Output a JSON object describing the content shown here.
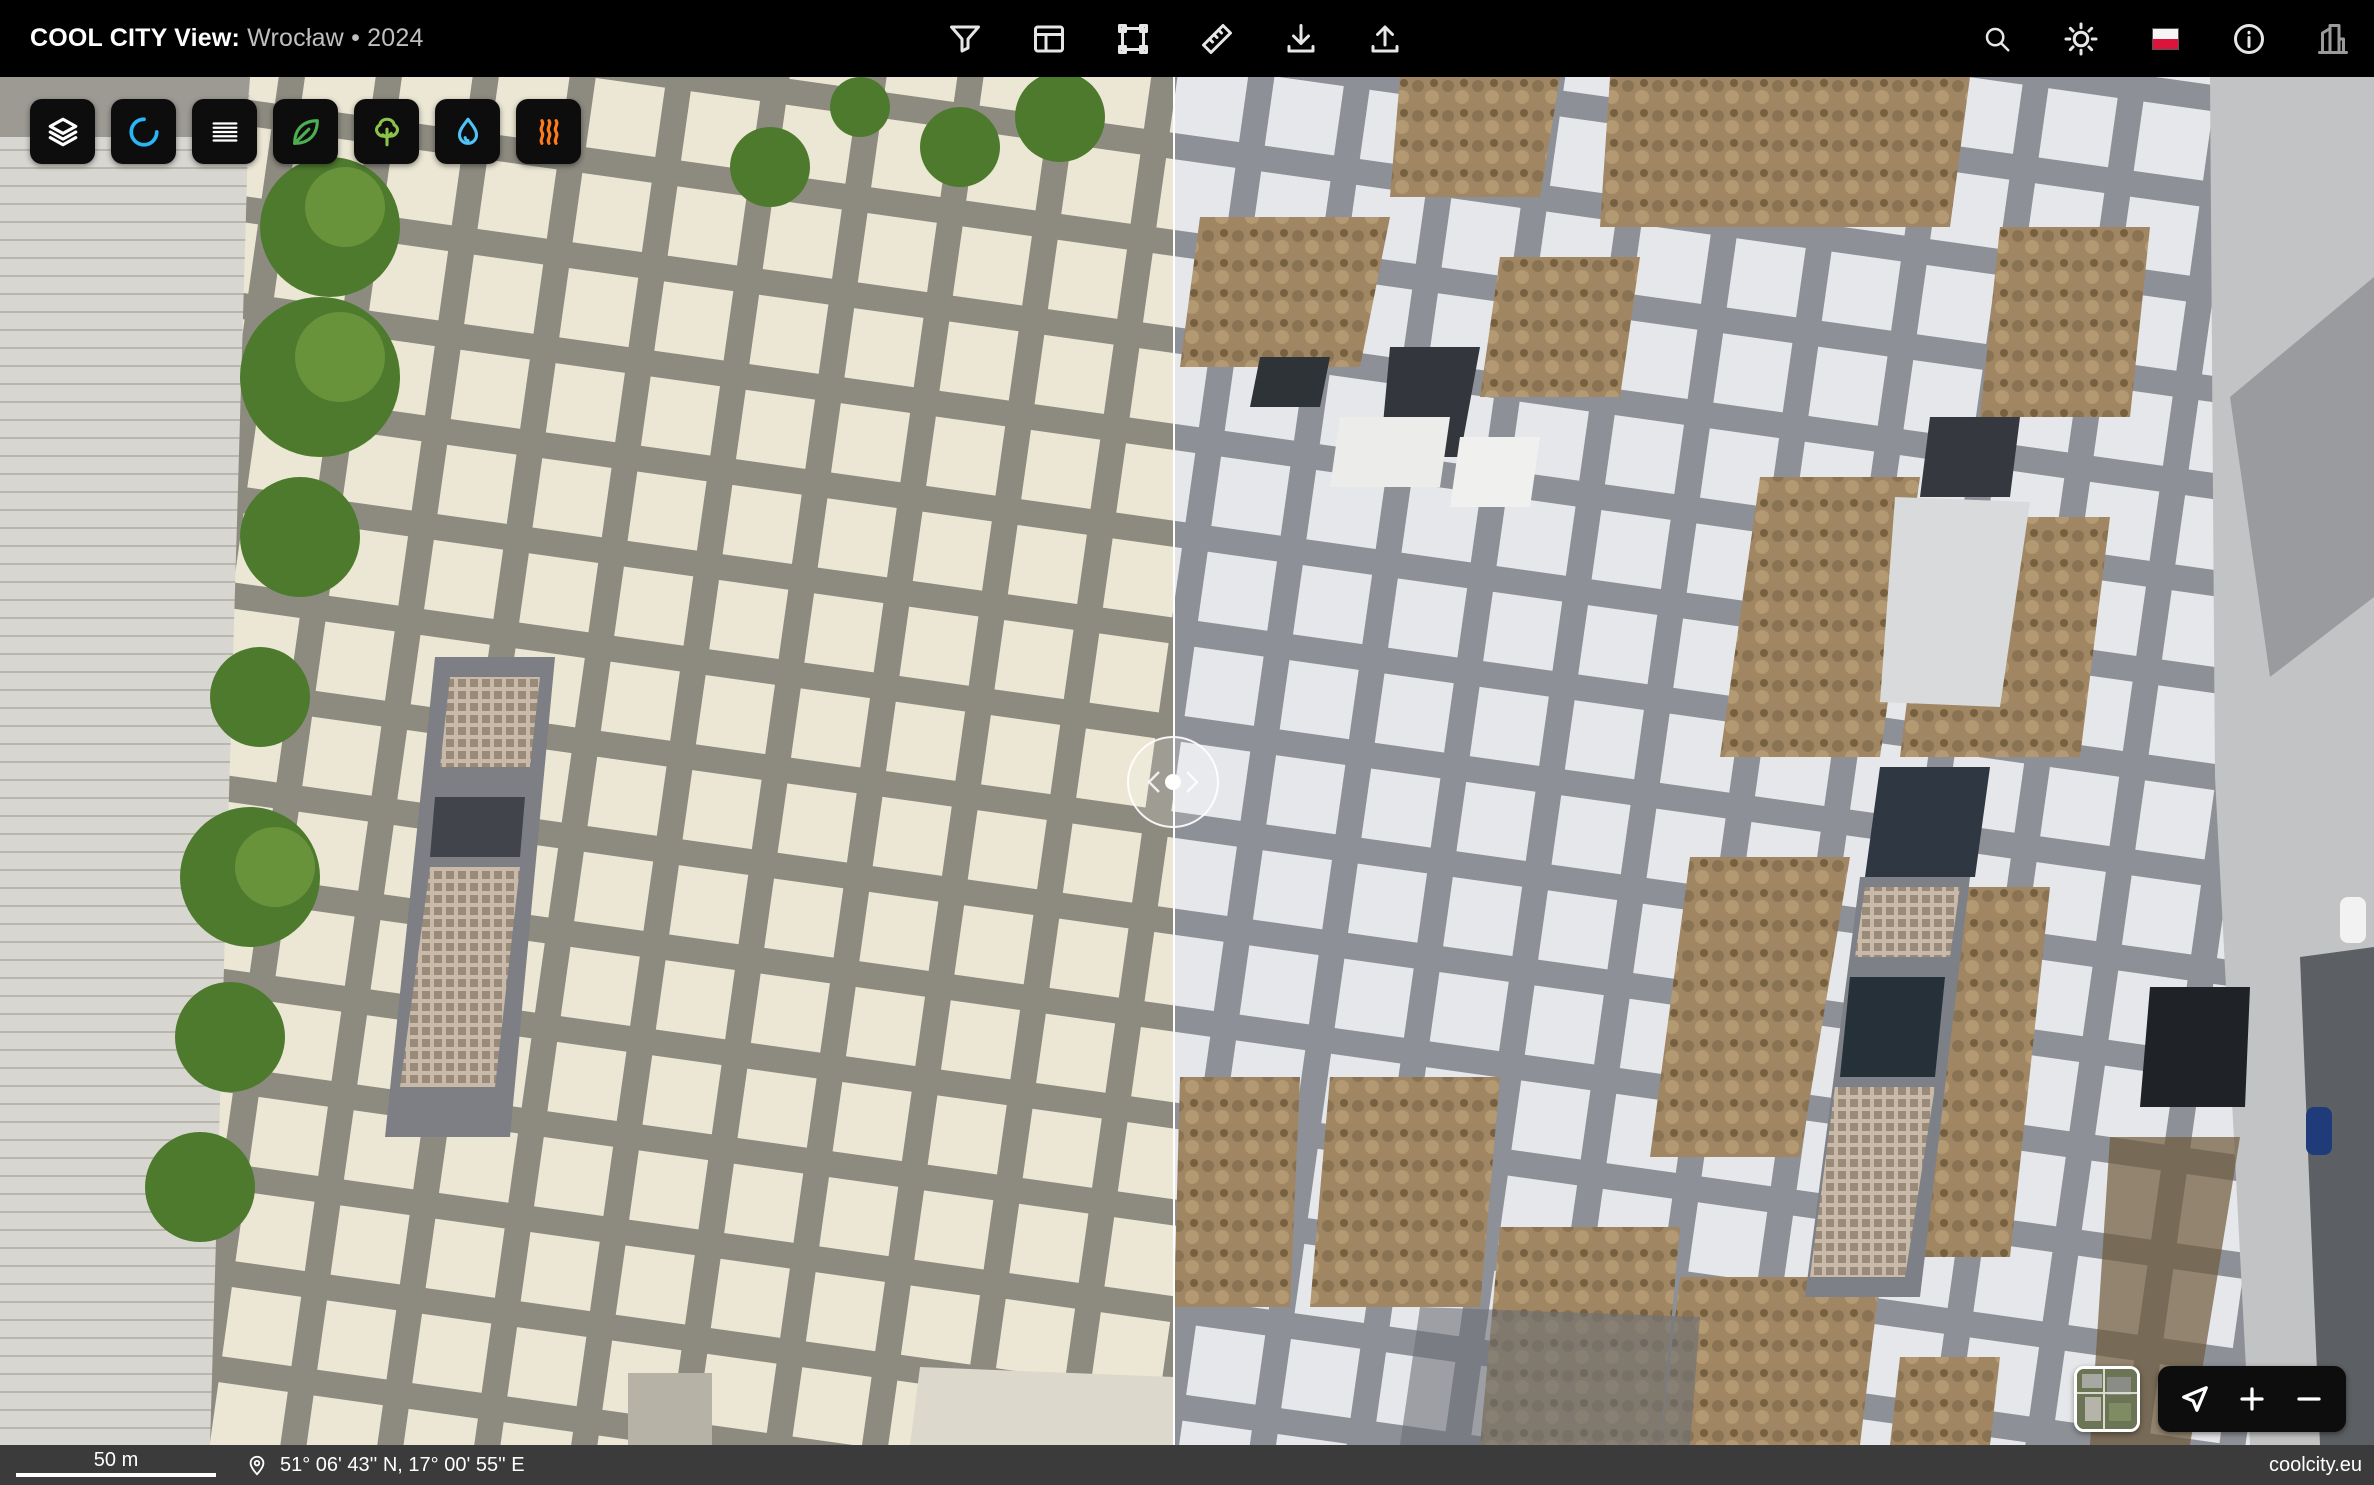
{
  "app": {
    "title_bold": "COOL CITY View:",
    "title_rest": " Wrocław • 2024"
  },
  "toolbar_center": [
    {
      "name": "filter-tool-button",
      "icon": "funnel-icon"
    },
    {
      "name": "layout-tool-button",
      "icon": "layout-icon"
    },
    {
      "name": "area-select-tool-button",
      "icon": "bounding-box-icon"
    },
    {
      "name": "measure-tool-button",
      "icon": "ruler-icon"
    },
    {
      "name": "download-button",
      "icon": "download-icon"
    },
    {
      "name": "share-button",
      "icon": "upload-icon"
    }
  ],
  "toolbar_right": [
    {
      "name": "search-button",
      "icon": "search-icon"
    },
    {
      "name": "theme-toggle-button",
      "icon": "sun-icon"
    },
    {
      "name": "language-button",
      "icon": "poland-flag-icon"
    },
    {
      "name": "info-button",
      "icon": "info-icon"
    },
    {
      "name": "buildings-button",
      "icon": "buildings-icon"
    }
  ],
  "layer_buttons": [
    {
      "name": "layers-button",
      "icon": "layers-icon",
      "color": "#ffffff"
    },
    {
      "name": "loading-layer-button",
      "icon": "spinner-icon",
      "color": "#29b6f6"
    },
    {
      "name": "legend-layer-button",
      "icon": "list-lines-icon",
      "color": "#ffffff"
    },
    {
      "name": "vegetation-layer-button",
      "icon": "leaf-icon",
      "color": "#4caf50"
    },
    {
      "name": "trees-layer-button",
      "icon": "tree-icon",
      "color": "#8bc34a"
    },
    {
      "name": "water-layer-button",
      "icon": "droplet-icon",
      "color": "#4fc3f7"
    },
    {
      "name": "heat-layer-button",
      "icon": "heat-waves-icon",
      "color": "#ff7a1a"
    }
  ],
  "compare": {
    "split_fraction": 0.4945
  },
  "statusbar": {
    "scale_label": "50 m",
    "coordinates": "51° 06' 43'' N, 17° 00' 55'' E",
    "site": "coolcity.eu"
  }
}
